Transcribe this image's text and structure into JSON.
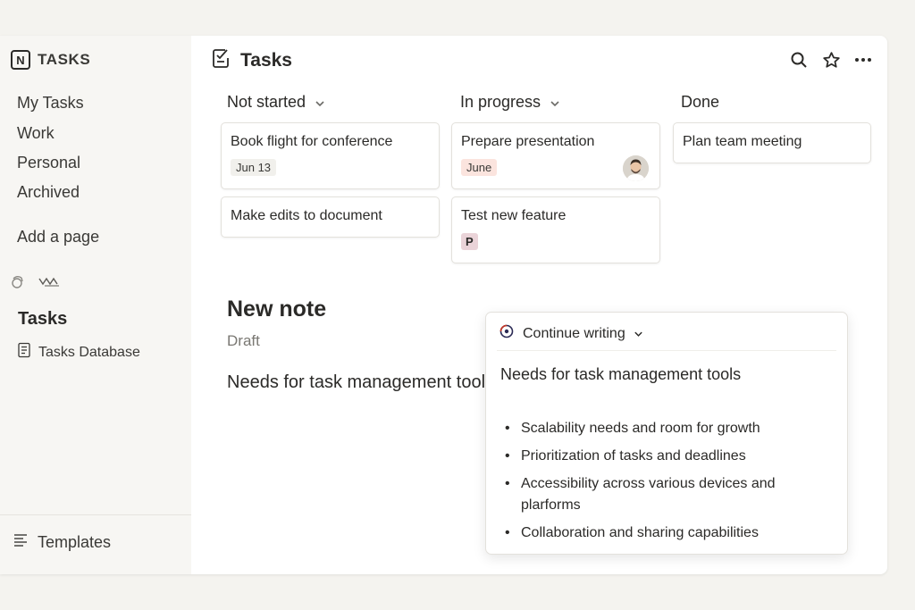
{
  "app": {
    "brand_logo": "N",
    "brand_name": "TASKS"
  },
  "sidebar": {
    "nav": [
      {
        "label": "My Tasks"
      },
      {
        "label": "Work"
      },
      {
        "label": "Personal"
      },
      {
        "label": "Archived"
      }
    ],
    "add_page": "Add a page",
    "section_title": "Tasks",
    "database": {
      "label": "Tasks Database",
      "icon": "database-icon"
    },
    "templates": {
      "label": "Templates",
      "icon": "lines-icon"
    }
  },
  "header": {
    "title": "Tasks",
    "icon": "checklist-icon",
    "actions": [
      "search-icon",
      "star-icon",
      "more-icon"
    ]
  },
  "board": {
    "columns": [
      {
        "label": "Not started",
        "cards": [
          {
            "title": "Book flight for conference",
            "tag": "Jun 13"
          },
          {
            "title": "Make edits to document"
          }
        ]
      },
      {
        "label": "In progress",
        "cards": [
          {
            "title": "Prepare presentation",
            "tag": "June",
            "has_avatar": true
          },
          {
            "title": "Test new feature",
            "tag": "P"
          }
        ]
      },
      {
        "label": "Done",
        "cards": [
          {
            "title": "Plan team meeting"
          }
        ]
      }
    ]
  },
  "note": {
    "title": "New note",
    "status": "Draft",
    "body": "Needs for task management tools"
  },
  "ai_popup": {
    "action": "Continue writing",
    "heading": "Needs for task management tools",
    "bullets": [
      "Scalability needs and room for growth",
      "Prioritization of tasks and deadlines",
      "Accessibility across various devices and plarforms",
      "Collaboration and  sharing capabilities"
    ]
  },
  "colors": {
    "background": "#f4f3ef",
    "sidebar": "#f7f6f3",
    "tag_grey": "#f1f0ec",
    "tag_pink": "#fbe4de",
    "tag_mauve": "#ead3d8",
    "ai_accent": "#c0392b"
  }
}
